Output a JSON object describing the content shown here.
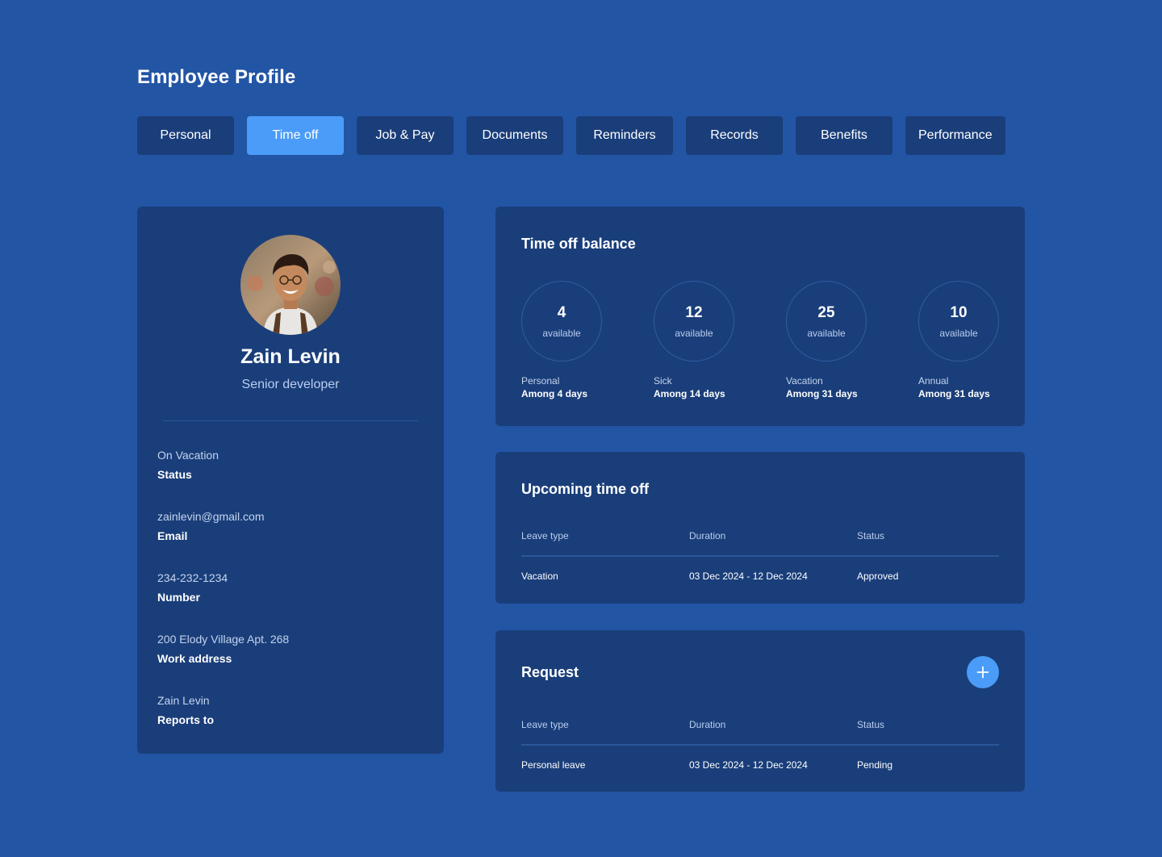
{
  "page": {
    "title": "Employee Profile"
  },
  "tabs": [
    {
      "label": "Personal",
      "active": false
    },
    {
      "label": "Time off",
      "active": true
    },
    {
      "label": "Job & Pay",
      "active": false
    },
    {
      "label": "Documents",
      "active": false
    },
    {
      "label": "Reminders",
      "active": false
    },
    {
      "label": "Records",
      "active": false
    },
    {
      "label": "Benefits",
      "active": false
    },
    {
      "label": "Performance",
      "active": false
    }
  ],
  "profile": {
    "name": "Zain Levin",
    "role": "Senior developer",
    "details": [
      {
        "value": "On Vacation",
        "label": "Status"
      },
      {
        "value": "zainlevin@gmail.com",
        "label": "Email"
      },
      {
        "value": "234-232-1234",
        "label": "Number"
      },
      {
        "value": "200 Elody Village Apt. 268",
        "label": "Work address"
      },
      {
        "value": "Zain Levin",
        "label": "Reports to"
      }
    ]
  },
  "balance": {
    "title": "Time off balance",
    "items": [
      {
        "value": "4",
        "caption": "available",
        "type": "Personal",
        "among": "Among 4 days"
      },
      {
        "value": "12",
        "caption": "available",
        "type": "Sick",
        "among": "Among 14 days"
      },
      {
        "value": "25",
        "caption": "available",
        "type": "Vacation",
        "among": "Among 31 days"
      },
      {
        "value": "10",
        "caption": "available",
        "type": "Annual",
        "among": "Among 31 days"
      }
    ]
  },
  "upcoming": {
    "title": "Upcoming time off",
    "headers": [
      "Leave type",
      "Duration",
      "Status"
    ],
    "rows": [
      [
        "Vacation",
        "03 Dec 2024 - 12 Dec 2024",
        "Approved"
      ]
    ]
  },
  "request": {
    "title": "Request",
    "add_icon": "plus-icon",
    "headers": [
      "Leave type",
      "Duration",
      "Status"
    ],
    "rows": [
      [
        "Personal leave",
        "03 Dec 2024 - 12 Dec 2024",
        "Pending"
      ]
    ]
  },
  "colors": {
    "background": "#2355a5",
    "card": "#1a3e7a",
    "accent": "#4a9cf8",
    "muted_text": "#b9cdf0"
  }
}
